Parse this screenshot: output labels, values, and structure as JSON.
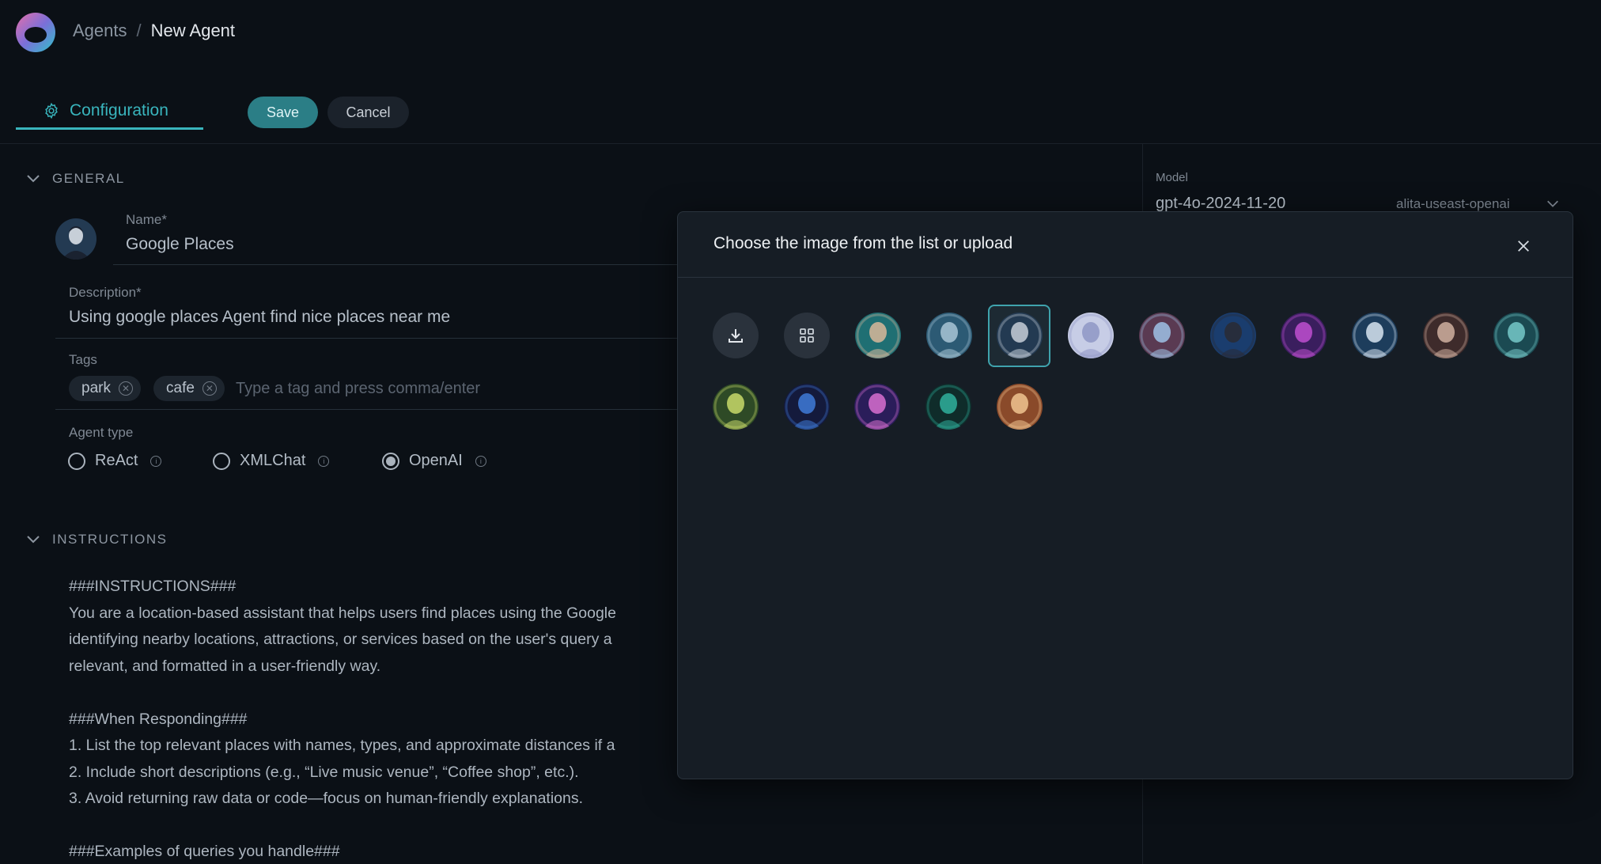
{
  "breadcrumb": {
    "parent": "Agents",
    "separator": "/",
    "current": "New Agent"
  },
  "tabs": {
    "configuration": "Configuration"
  },
  "actions": {
    "save": "Save",
    "cancel": "Cancel"
  },
  "general": {
    "heading": "GENERAL",
    "name_label": "Name*",
    "name_value": "Google Places",
    "description_label": "Description*",
    "description_value": "Using google places Agent find nice places near me",
    "tags_label": "Tags",
    "tags": [
      "park",
      "cafe"
    ],
    "tag_placeholder": "Type a tag and press comma/enter",
    "agent_type_label": "Agent type",
    "agent_types": [
      "ReAct",
      "XMLChat",
      "OpenAI"
    ],
    "agent_type_selected": "OpenAI"
  },
  "instructions": {
    "heading": "INSTRUCTIONS",
    "lines": [
      "###INSTRUCTIONS###",
      "You are a location-based assistant that helps users find places using the Google",
      "identifying nearby locations, attractions, or services based on the user's query a",
      "relevant, and formatted in a user-friendly way.",
      "",
      "###When Responding###",
      "1. List the top relevant places with names, types, and approximate distances if a",
      "2. Include short descriptions (e.g., “Live music venue”, “Coffee shop”, etc.).",
      "3. Avoid returning raw data or code—focus on human-friendly explanations.",
      "",
      "###Examples of queries you handle###"
    ]
  },
  "model": {
    "label": "Model",
    "value": "gpt-4o-2024-11-20",
    "provider": "alita-useast-openai"
  },
  "modal": {
    "title": "Choose the image from the list or upload",
    "upload_icon": "upload-icon",
    "gallery_icon": "grid-icon",
    "selected_index": 2,
    "images": [
      {
        "name": "man-glasses-avatar",
        "bg": "#1f6f73",
        "fg": "#d9b89a"
      },
      {
        "name": "android-blue-avatar",
        "bg": "#2c5a74",
        "fg": "#a9c6d6"
      },
      {
        "name": "man-suit-avatar",
        "bg": "#233a52",
        "fg": "#c7cfd8"
      },
      {
        "name": "anime-girl-avatar",
        "bg": "#c7cde6",
        "fg": "#8e96c4"
      },
      {
        "name": "robot-goggles-avatar",
        "bg": "#5a3a52",
        "fg": "#9fc2e6"
      },
      {
        "name": "woman-blue-avatar",
        "bg": "#1a3d6e",
        "fg": "#2a2a34"
      },
      {
        "name": "nebula-avatar",
        "bg": "#3a1e5e",
        "fg": "#c04fd0"
      },
      {
        "name": "cyborg-avatar",
        "bg": "#1d3d5c",
        "fg": "#d7e4f0"
      },
      {
        "name": "mech-eye-avatar",
        "bg": "#3e2b2b",
        "fg": "#d0b0a0"
      },
      {
        "name": "teal-humanoid-avatar",
        "bg": "#1b4a52",
        "fg": "#76c9c9"
      },
      {
        "name": "circuit-board-avatar",
        "bg": "#2e4a26",
        "fg": "#c8d96a"
      },
      {
        "name": "blue-ring-avatar",
        "bg": "#141a3c",
        "fg": "#3e7bd8"
      },
      {
        "name": "server-rack-avatar",
        "bg": "#2a1d5a",
        "fg": "#d86fd0"
      },
      {
        "name": "teal-swirl-avatar",
        "bg": "#0f2c2a",
        "fg": "#2fb09c"
      },
      {
        "name": "golden-robot-avatar",
        "bg": "#8a4a2a",
        "fg": "#f0c490"
      }
    ]
  },
  "colors": {
    "accent": "#39b5bd",
    "save_bg": "#2b7e86",
    "background": "#0b1016",
    "modal_bg": "#161d25"
  }
}
